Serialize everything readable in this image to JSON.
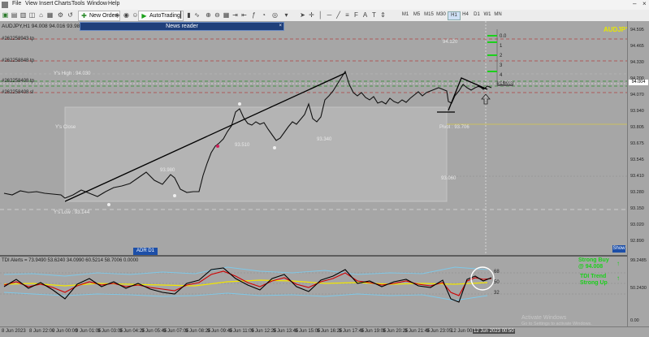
{
  "menu": [
    "File",
    "View",
    "Insert",
    "Charts",
    "Tools",
    "Window",
    "Help"
  ],
  "toolbar": {
    "new_order_label": "New Order",
    "autotrading_label": "AutoTrading",
    "timeframes": [
      "M1",
      "M5",
      "M15",
      "M30",
      "H1",
      "H4",
      "D1",
      "W1",
      "MN"
    ]
  },
  "chart": {
    "symbol_info": "AUDJPY,H1  94.008  94.016  93.988  94.004",
    "symbol_corner": "AUDJPY",
    "news_reader": "News reader",
    "adr_label": "ADR D1",
    "show_label": "Show",
    "y_high_label": "Y's High : 94.030",
    "y_close_label": "Y's Close",
    "y_low_label": "Y's Low : 93.144",
    "pivot_label": "Pivot : 93.706",
    "order_labels": [
      "#262258943 tp",
      "#262258848 tp",
      "#262258408 tp",
      "#262258408 sl"
    ],
    "fib_labels": [
      "0.0",
      "1",
      "2",
      "3",
      "4",
      "5"
    ],
    "level_tags": [
      "94.120",
      "94.098",
      "93.980",
      "93.510",
      "93.340",
      "93.060"
    ]
  },
  "indicator": {
    "title": "TDI Alerts = 73.9490 53.6240 34.0990 60.5214 58.7006 0.0000",
    "signal_1a": "Strong Buy",
    "signal_1b": "@ 94.008",
    "signal_2a": "TDI Trend",
    "signal_2b": "Strong Up",
    "levels": [
      "68",
      "50",
      "32"
    ]
  },
  "price_axis": [
    "94.595",
    "94.465",
    "94.330",
    "94.200",
    "94.070",
    "93.940",
    "93.805",
    "93.675",
    "93.545",
    "93.410",
    "93.280",
    "93.150",
    "93.020",
    "92.890"
  ],
  "price_box": "94.004",
  "indicator_axis": [
    "99.2485",
    "50.2430",
    "0.00"
  ],
  "time_axis": [
    "8 Jun 2023",
    "8 Jun 22:00",
    "9 Jun 00:00",
    "9 Jun 01:05",
    "9 Jun 03:05",
    "9 Jun 04:25",
    "9 Jun 05:45",
    "9 Jun 07:05",
    "9 Jun 08:25",
    "9 Jun 09:45",
    "9 Jun 11:05",
    "9 Jun 12:25",
    "9 Jun 13:45",
    "9 Jun 15:05",
    "9 Jun 16:25",
    "9 Jun 17:45",
    "9 Jun 19:05",
    "9 Jun 20:25",
    "9 Jun 21:45",
    "9 Jun 23:05",
    "12 Jun 00:25"
  ],
  "time_cursor": "12 Jun 2023 00:50",
  "watermark": {
    "line1": "Activate Windows",
    "line2": "Go to Settings to activate Windows."
  },
  "colors": {
    "bg": "#a6a6a6",
    "signal_green": "#1bd01b",
    "tdi_yellow": "#f2e600",
    "tdi_red": "#d00000",
    "band_blue": "#7ec8e8",
    "order_red": "#b34040",
    "order_green": "#2a8a2a"
  }
}
